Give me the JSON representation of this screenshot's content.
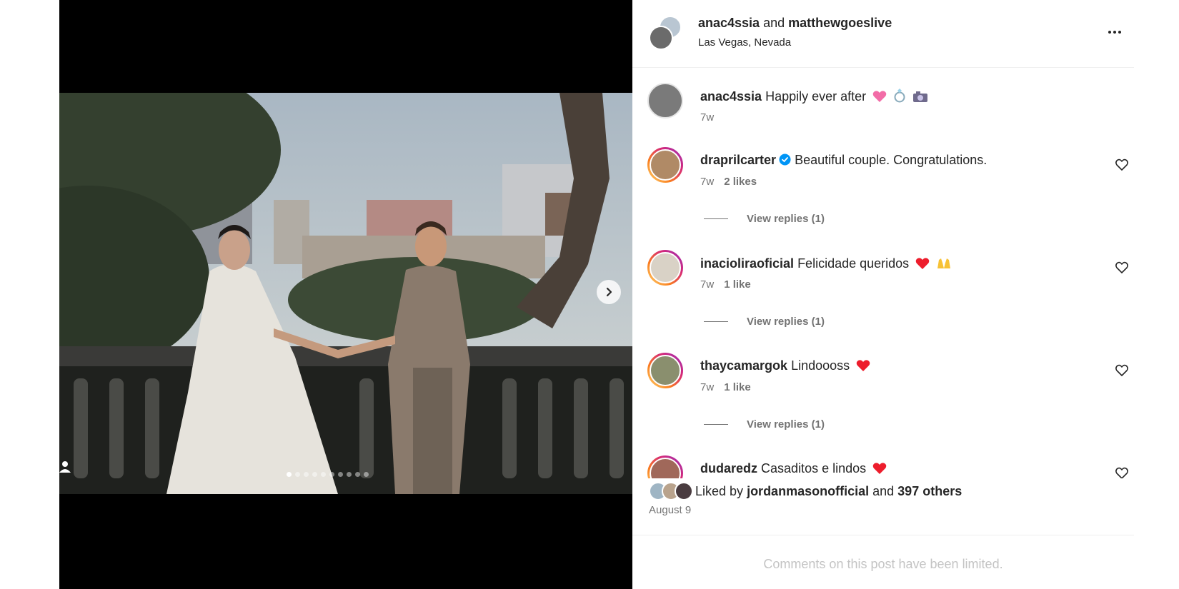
{
  "header": {
    "user1": "anac4ssia",
    "joiner": "and",
    "user2": "matthewgoeslive",
    "location": "Las Vegas, Nevada"
  },
  "media": {
    "carousel_count": 10,
    "carousel_active_index": 0,
    "next_icon": "chevron-right-icon",
    "tag_icon": "user-tag-icon"
  },
  "caption": {
    "username": "anac4ssia",
    "text": "Happily ever after",
    "emojis": [
      "pink-heart",
      "ring",
      "camera"
    ],
    "time": "7w"
  },
  "comments": [
    {
      "username": "draprilcarter",
      "verified": true,
      "text": "Beautiful couple. Congratulations.",
      "time": "7w",
      "likes": "2 likes",
      "replies": "View replies (1)"
    },
    {
      "username": "inaciolirаoficial",
      "verified": false,
      "text": "Felicidade queridos",
      "emojis": [
        "red-heart",
        "raising-hands"
      ],
      "time": "7w",
      "likes": "1 like",
      "replies": "View replies (1)"
    },
    {
      "username": "thaycamargok",
      "verified": false,
      "text": "Lindoooss",
      "emojis": [
        "red-heart"
      ],
      "time": "7w",
      "likes": "1 like",
      "replies": "View replies (1)"
    },
    {
      "username": "dudaredz",
      "verified": false,
      "text": "Casaditos e lindos",
      "emojis": [
        "red-heart"
      ]
    }
  ],
  "likes": {
    "prefix": "Liked by",
    "user": "jordanmasonofficial",
    "joiner": "and",
    "others": "397 others"
  },
  "date": "August 9",
  "limited_notice": "Comments on this post have been limited.",
  "colors": {
    "text": "#262626",
    "secondary": "#737373",
    "verified": "#0095f6",
    "heart_red": "#ed1d2c"
  }
}
